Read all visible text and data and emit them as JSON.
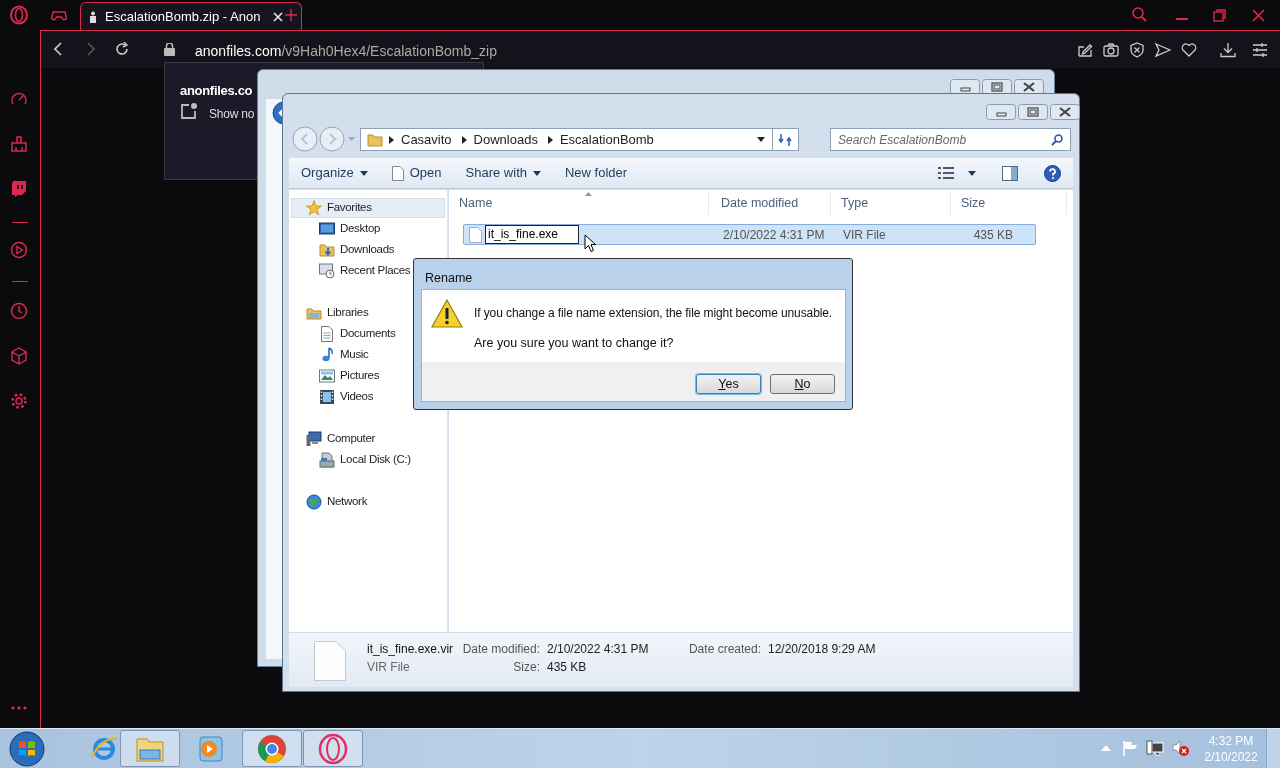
{
  "browser": {
    "tabs": [
      {
        "label": "EscalationBomb.zip - Anon",
        "selected": true
      }
    ],
    "address": {
      "domain": "anonfiles.com",
      "path": "/v9Hah0Hex4/EscalationBomb_zip"
    },
    "popup": {
      "title": "anonfiles.co",
      "item": "Show no"
    }
  },
  "explorer": {
    "breadcrumb": [
      "Casavito",
      "Downloads",
      "EscalationBomb"
    ],
    "search": {
      "placeholder": "Search EscalationBomb"
    },
    "toolbar": [
      {
        "label": "Organize",
        "dropdown": true,
        "kind": "menu"
      },
      {
        "label": "Open",
        "dropdown": false,
        "kind": "open"
      },
      {
        "label": "Share with",
        "dropdown": true,
        "kind": "menu"
      },
      {
        "label": "New folder",
        "dropdown": false,
        "kind": "plain"
      }
    ],
    "nav": [
      {
        "label": "Favorites",
        "kind": "star",
        "selected": true,
        "children": [
          {
            "label": "Desktop",
            "kind": "desktop",
            "selected": false
          },
          {
            "label": "Downloads",
            "kind": "downloads",
            "selected": false
          },
          {
            "label": "Recent Places",
            "kind": "recent",
            "selected": false
          }
        ]
      },
      {
        "label": "Libraries",
        "kind": "libraries",
        "selected": false,
        "children": [
          {
            "label": "Documents",
            "kind": "documents",
            "selected": false
          },
          {
            "label": "Music",
            "kind": "music",
            "selected": false
          },
          {
            "label": "Pictures",
            "kind": "pictures",
            "selected": false
          },
          {
            "label": "Videos",
            "kind": "videos",
            "selected": false
          }
        ]
      },
      {
        "label": "Computer",
        "kind": "computer",
        "selected": false,
        "children": [
          {
            "label": "Local Disk (C:)",
            "kind": "disk",
            "selected": false
          }
        ]
      },
      {
        "label": "Network",
        "kind": "network",
        "selected": false
      }
    ],
    "columns": [
      "Name",
      "Date modified",
      "Type",
      "Size"
    ],
    "rows": [
      {
        "name": "it_is_fine.exe",
        "date": "2/10/2022 4:31 PM",
        "type": "VIR File",
        "size": "435 KB",
        "selected": true,
        "editing": true
      }
    ],
    "details": {
      "name": "it_is_fine.exe.vir",
      "type": "VIR File",
      "fields": [
        {
          "label": "Date modified:",
          "value": "2/10/2022 4:31 PM"
        },
        {
          "label": "Size:",
          "value": "435 KB"
        },
        {
          "label": "Date created:",
          "value": "12/20/2018 9:29 AM"
        }
      ]
    }
  },
  "dialog": {
    "title": "Rename",
    "message": "If you change a file name extension, the file might become unusable.",
    "question": "Are you sure you want to change it?",
    "buttons": [
      {
        "label": "Yes",
        "default": true
      },
      {
        "label": "No",
        "default": false
      }
    ]
  },
  "taskbar": {
    "apps": [
      {
        "kind": "ie",
        "open": false
      },
      {
        "kind": "explorer",
        "open": true
      },
      {
        "kind": "media",
        "open": false
      },
      {
        "kind": "chrome",
        "open": true
      },
      {
        "kind": "opera",
        "open": true
      }
    ],
    "time": "4:32 PM",
    "date": "2/10/2022"
  }
}
